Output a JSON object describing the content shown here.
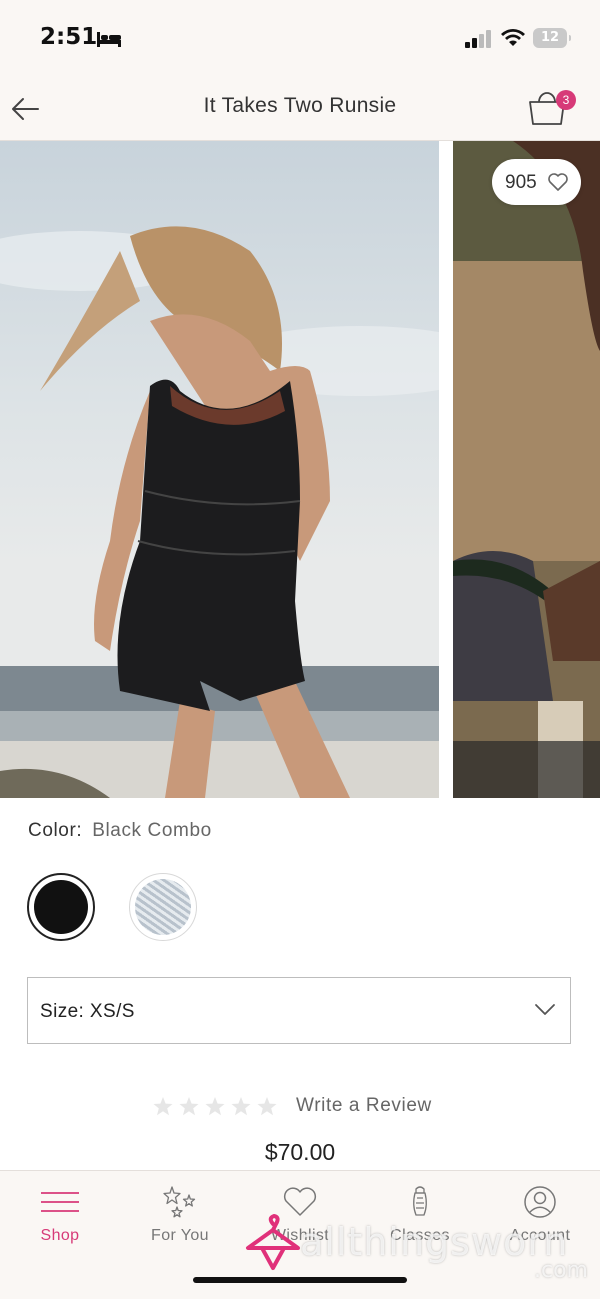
{
  "status_bar": {
    "time": "2:51",
    "battery": "12"
  },
  "header": {
    "title": "It Takes Two Runsie",
    "cart_count": "3"
  },
  "gallery": {
    "like_count": "905"
  },
  "product": {
    "color_label": "Color:",
    "color_value": "Black Combo",
    "swatches": [
      "black-combo",
      "grey-stripe"
    ],
    "size_label": "Size: XS/S",
    "rating": 0,
    "rating_max": 5,
    "review_link": "Write a Review",
    "price": "$70.00"
  },
  "tabbar": {
    "tabs": [
      {
        "label": "Shop",
        "icon": "menu-lines-icon",
        "active": true
      },
      {
        "label": "For You",
        "icon": "sparkle-stars-icon",
        "active": false
      },
      {
        "label": "Wishlist",
        "icon": "heart-icon",
        "active": false
      },
      {
        "label": "Classes",
        "icon": "kettlebell-icon",
        "active": false
      },
      {
        "label": "Account",
        "icon": "user-icon",
        "active": false
      }
    ]
  },
  "watermark": {
    "text": "allthingsworn",
    "suffix": ".com"
  },
  "colors": {
    "accent": "#d73a78",
    "background": "#faf7f4"
  }
}
